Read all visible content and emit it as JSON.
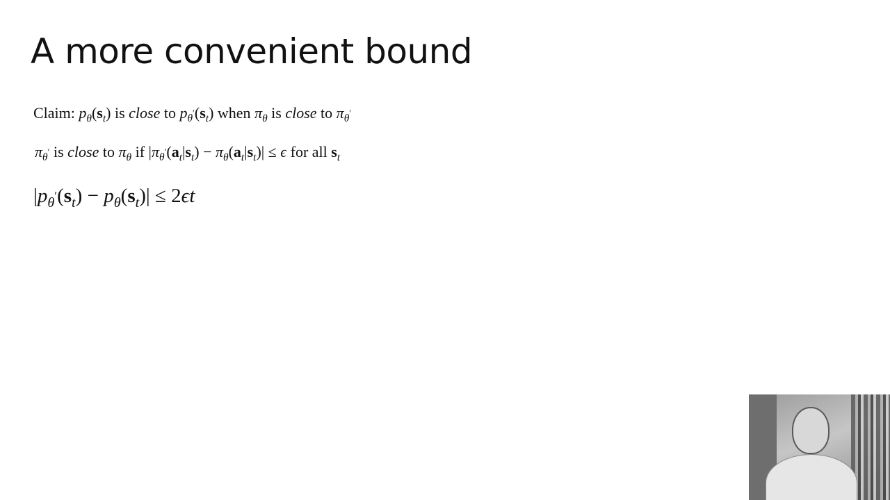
{
  "slide": {
    "title": "A more convenient bound"
  },
  "lines": {
    "claim": {
      "label": "Claim:",
      "is1": "is",
      "close1": "close",
      "to1": "to",
      "when": "when",
      "is2": "is",
      "close2": "close",
      "to2": "to"
    },
    "condition": {
      "is": "is",
      "close": "close",
      "to": "to",
      "if": "if",
      "forall": "for all"
    }
  },
  "webcam": {
    "description_icon": "presenter-video-icon"
  }
}
